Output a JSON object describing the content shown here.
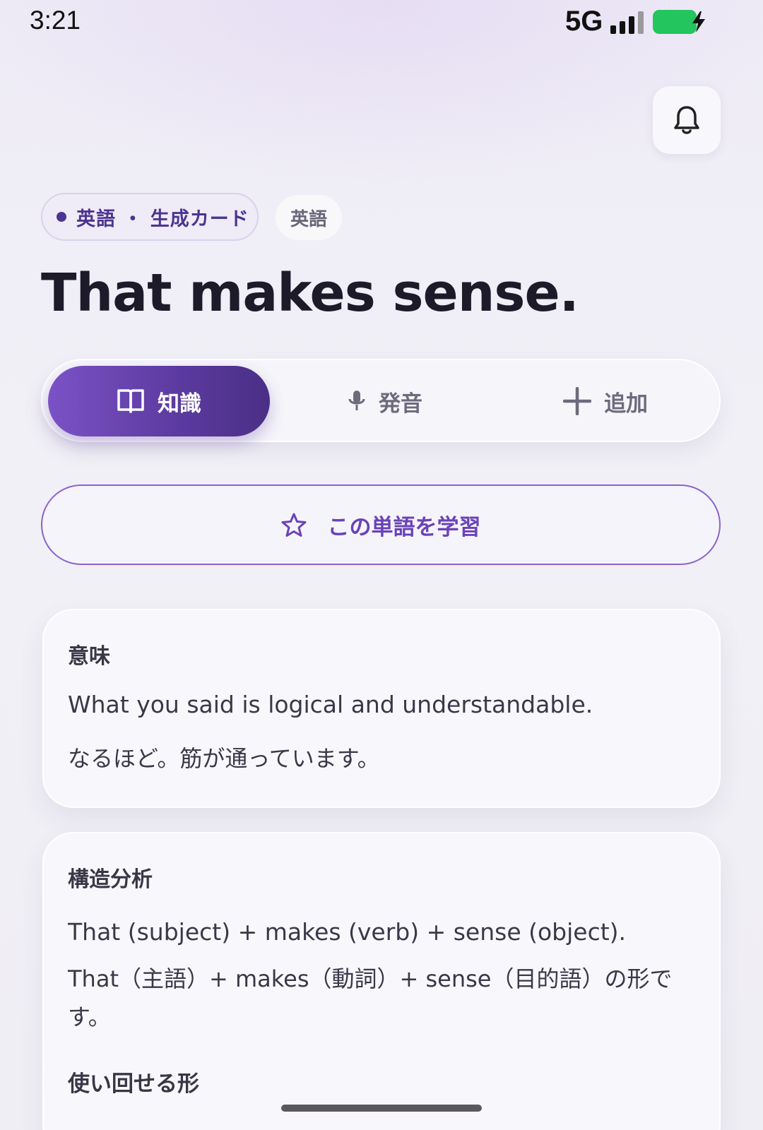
{
  "status_bar": {
    "time": "3:21",
    "network": "5G",
    "battery_color": "#22c55e",
    "battery_state": "charging"
  },
  "header": {
    "bell_icon": "bell-icon"
  },
  "chips": {
    "source": "英語 ・ 生成カード",
    "language": "英語"
  },
  "phrase": {
    "title": "That makes sense."
  },
  "tabs": [
    {
      "label": "知識",
      "icon": "book-open-icon",
      "active": true
    },
    {
      "label": "発音",
      "icon": "microphone-icon",
      "active": false
    },
    {
      "label": "追加",
      "icon": "plus-icon",
      "active": false
    }
  ],
  "study_button": {
    "label": "この単語を学習",
    "icon": "star-icon"
  },
  "meaning_card": {
    "label": "意味",
    "english": "What you said is logical and understandable.",
    "japanese": "なるほど。筋が通っています。"
  },
  "structure_card": {
    "label": "構造分析",
    "english": "That (subject) + makes (verb) + sense (object).",
    "japanese": "That（主語）+ makes（動詞）+ sense（目的語）の形です。",
    "reusable_label": "使い回せる形"
  },
  "colors": {
    "accent": "#6a42b8",
    "accent_dark": "#4b3590",
    "text_dark": "#1d1a2a"
  }
}
